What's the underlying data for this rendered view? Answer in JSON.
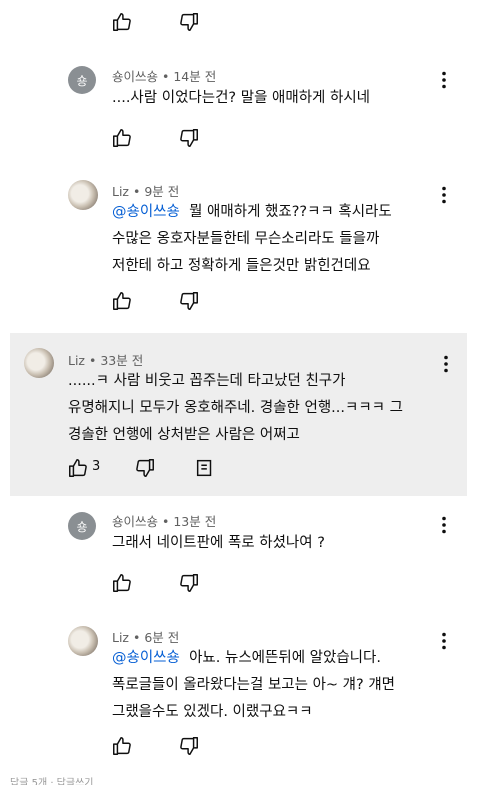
{
  "c1": {
    "author": "숑이쓰숑",
    "time": "14분 전",
    "avatar_letter": "숑",
    "text": "....사람 이었다는건? 말을 애매하게 하시네"
  },
  "c2": {
    "author": "Liz",
    "time": "9분 전",
    "mention": "@숑이쓰숑",
    "lines": [
      "뭘 애매하게 했죠??ㅋㅋ 혹시라도",
      "수많은 옹호자분들한테 무슨소리라도 들을까",
      "저한테 하고 정확하게 들은것만 밝힌건데요"
    ]
  },
  "c3": {
    "author": "Liz",
    "time": "33분 전",
    "lines": [
      "......ㅋ 사람 비웃고 꼽주는데 타고났던 친구가",
      "유명해지니 모두가 옹호해주네. 경솔한 언행...ㅋㅋㅋ 그",
      "경솔한 언행에 상처받은 사람은 어쩌고"
    ],
    "like_count": "3"
  },
  "c4": {
    "author": "숑이쓰숑",
    "time": "13분 전",
    "avatar_letter": "숑",
    "text": "그래서 네이트판에 폭로 하셨나여 ?"
  },
  "c5": {
    "author": "Liz",
    "time": "6분 전",
    "mention": "@숑이쓰숑",
    "lines": [
      "아뇨. 뉴스에뜬뒤에 알았습니다.",
      "폭로글들이 올라왔다는걸 보고는 아~ 걔? 걔면",
      "그랬을수도 있겠다. 이랬구요ㅋㅋ"
    ]
  },
  "footer": {
    "text": "답글 5개 · 답글쓰기"
  },
  "icons": {
    "like": "thumbs-up-icon",
    "dislike": "thumbs-down-icon",
    "reply": "reply-icon",
    "more": "kebab-menu-icon"
  }
}
